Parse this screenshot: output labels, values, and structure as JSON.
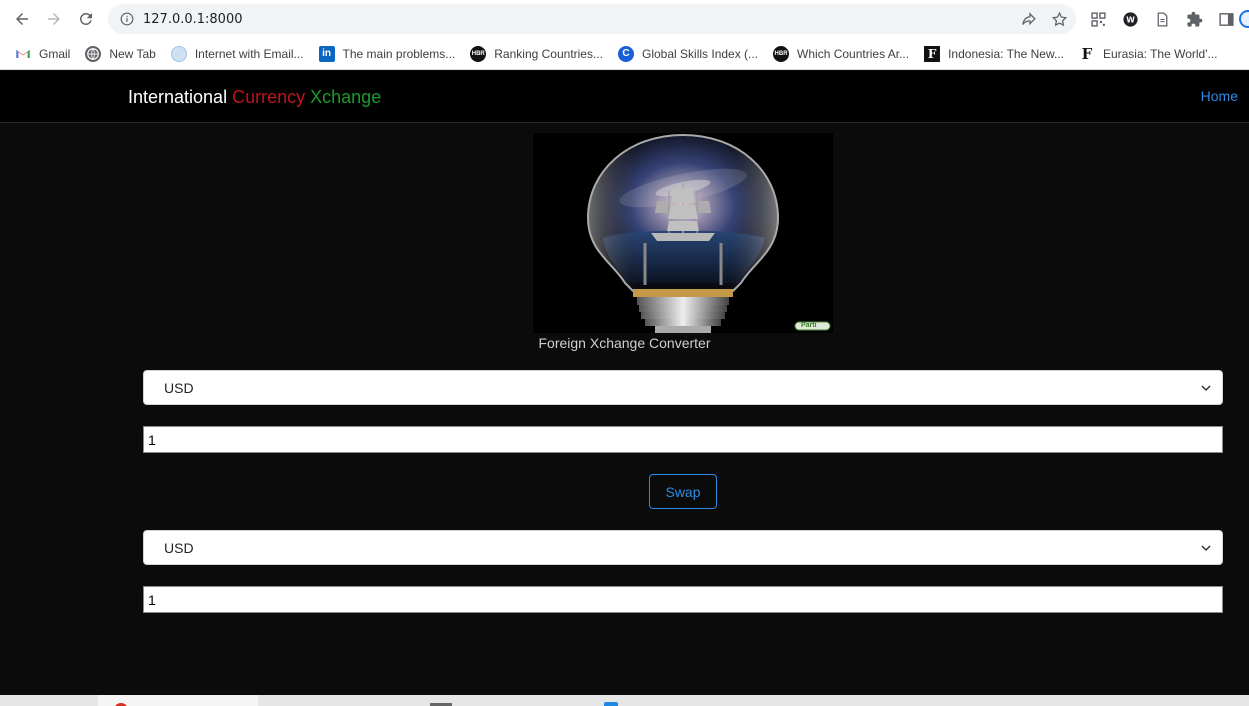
{
  "browser": {
    "url": "127.0.0.1:8000",
    "bookmarks": [
      {
        "label": "Gmail",
        "icon": "gmail-icon",
        "color": "#ea4335"
      },
      {
        "label": "New Tab",
        "icon": "globe-icon",
        "color": "#5f6368"
      },
      {
        "label": "Internet with Email...",
        "icon": "web-icon",
        "color": "#9fc1e8"
      },
      {
        "label": "The main problems...",
        "icon": "linkedin-icon",
        "color": "#0a66c2"
      },
      {
        "label": "Ranking Countries...",
        "icon": "hbr-icon",
        "color": "#111111"
      },
      {
        "label": "Global Skills Index (...",
        "icon": "coursera-icon",
        "color": "#1a5fd6"
      },
      {
        "label": "Which Countries Ar...",
        "icon": "hbr-icon",
        "color": "#111111"
      },
      {
        "label": "Indonesia: The New...",
        "icon": "forbes-icon",
        "color": "#111111"
      },
      {
        "label": "Eurasia: The World'...",
        "icon": "forbes-icon",
        "color": "#111111"
      }
    ]
  },
  "navbar": {
    "brand_part1": "International",
    "brand_part2": "Currency",
    "brand_part3": "Xchange",
    "home_link": "Home"
  },
  "main": {
    "caption": "Foreign Xchange Converter",
    "watermark": "Parti",
    "from_currency": "USD",
    "from_amount": "1",
    "swap_label": "Swap",
    "to_currency": "USD",
    "to_amount": "1"
  },
  "colors": {
    "currency": "#c0131b",
    "xchange": "#1c9a2a",
    "link": "#2f8be6"
  }
}
